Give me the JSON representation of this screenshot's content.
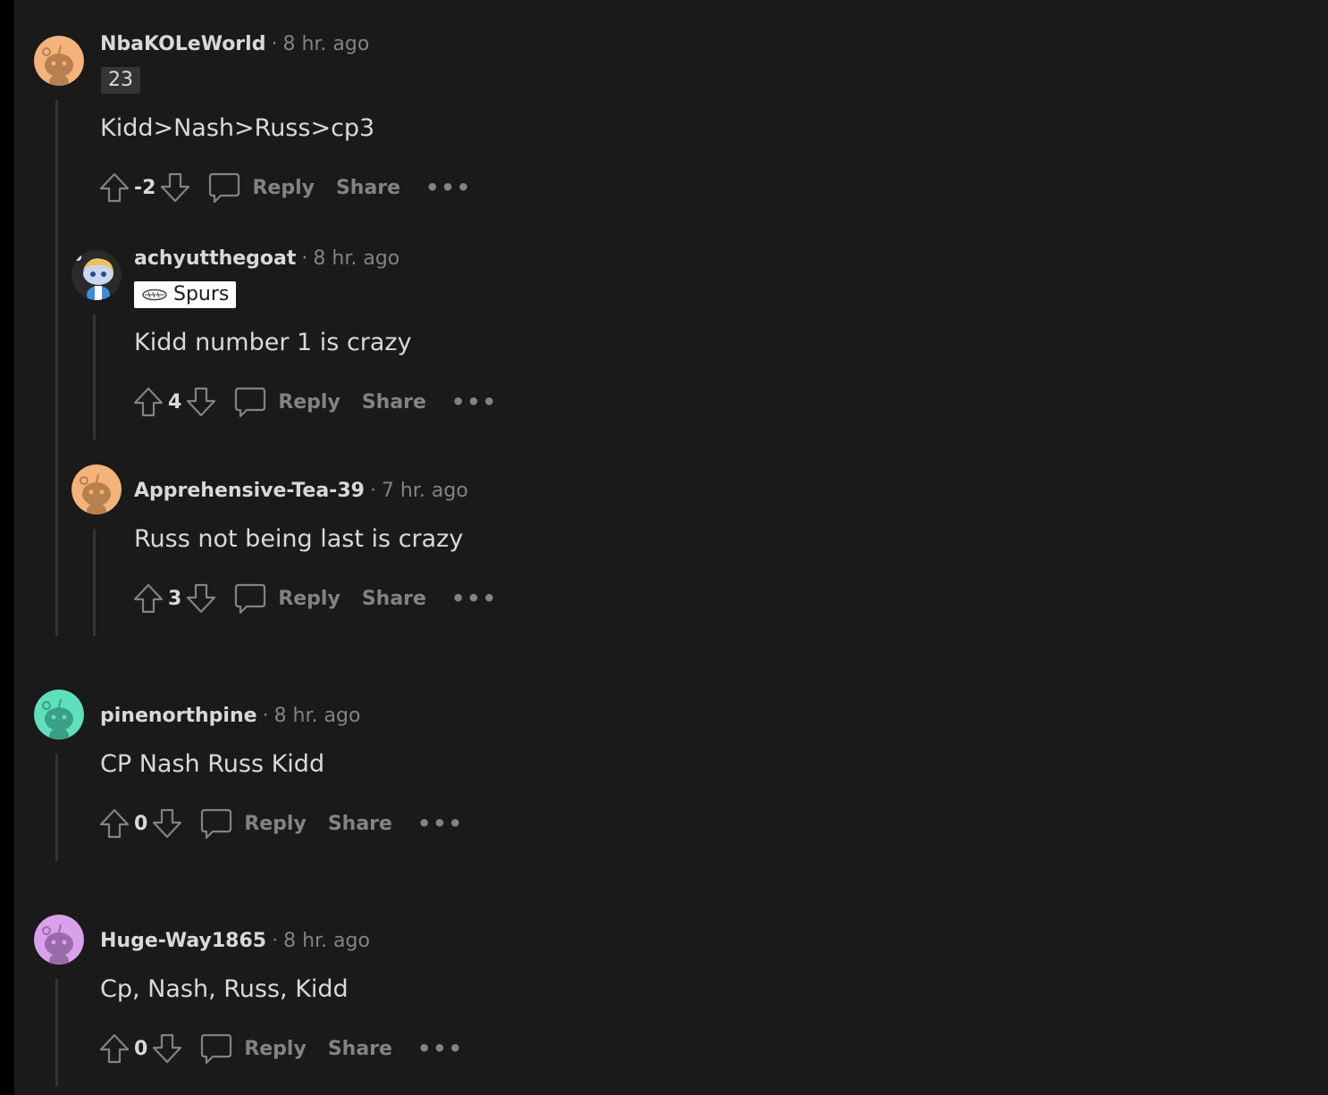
{
  "labels": {
    "reply": "Reply",
    "share": "Share",
    "more": "•••",
    "separator": "·"
  },
  "comments": [
    {
      "author": "NbaKOLeWorld",
      "time": "8 hr. ago",
      "flair": "23",
      "body": "Kidd>Nash>Russ>cp3",
      "score": "-2",
      "avatar_color": "#f3b37a",
      "replies": [
        {
          "author": "achyutthegoat",
          "time": "8 hr. ago",
          "flair": "Spurs",
          "flair_icon": "spurs-logo-icon",
          "body": "Kidd number 1 is crazy",
          "score": "4",
          "avatar_color": "#2a2a2b"
        },
        {
          "author": "Apprehensive-Tea-39",
          "time": "7 hr. ago",
          "body": "Russ not being last is crazy",
          "score": "3",
          "avatar_color": "#f3b37a"
        }
      ]
    },
    {
      "author": "pinenorthpine",
      "time": "8 hr. ago",
      "body": "CP Nash Russ Kidd",
      "score": "0",
      "avatar_color": "#5fe0bd"
    },
    {
      "author": "Huge-Way1865",
      "time": "8 hr. ago",
      "body": "Cp, Nash, Russ, Kidd",
      "score": "0",
      "avatar_color": "#d9a0ec"
    }
  ]
}
